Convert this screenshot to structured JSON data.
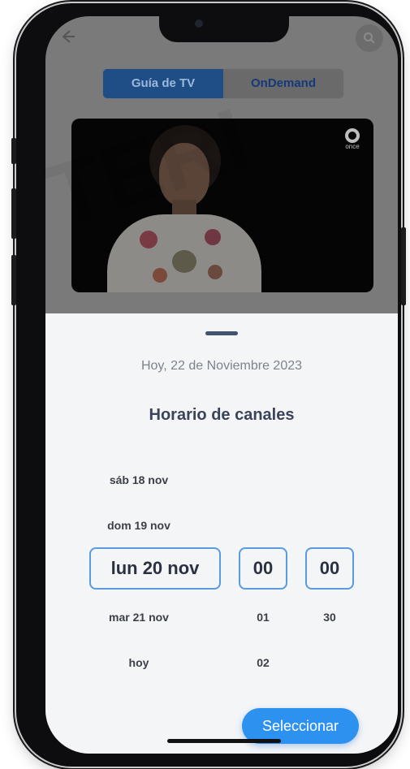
{
  "tabs": {
    "guia": "Guía de TV",
    "ondemand": "OnDemand"
  },
  "video": {
    "channel_logo_text": "once"
  },
  "sheet": {
    "date_label": "Hoy, 22 de Noviembre 2023",
    "title": "Horario de canales",
    "days": [
      "sáb 18 nov",
      "dom 19 nov",
      "lun 20 nov",
      "mar 21 nov",
      "hoy"
    ],
    "selected_day": "lun 20 nov",
    "hours_selected": "00",
    "hours": [
      "01",
      "02"
    ],
    "minutes_selected": "00",
    "minutes": [
      "30"
    ],
    "select_button": "Seleccionar"
  },
  "icons": [
    "back-arrow-icon",
    "search-icon",
    "once-logo-icon"
  ]
}
